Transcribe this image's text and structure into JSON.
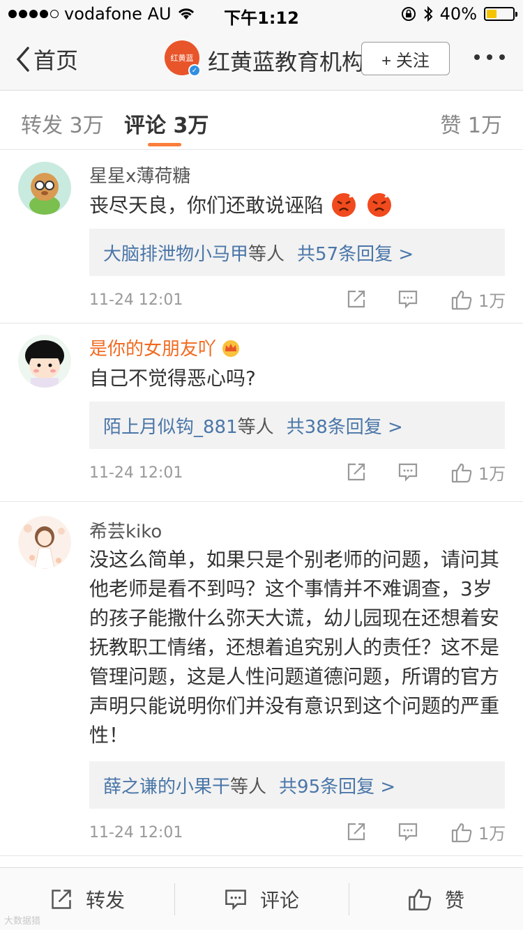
{
  "status_bar": {
    "carrier": "vodafone AU",
    "time": "下午1:12",
    "battery_percent": "40%",
    "battery_level": 0.4
  },
  "nav": {
    "back_label": "首页",
    "org_avatar_text": "红黄蓝",
    "org_name": "红黄蓝教育机构",
    "follow_label": "+ 关注"
  },
  "tabs": [
    {
      "label": "转发 3万"
    },
    {
      "label": "评论 3万"
    },
    {
      "label": "赞 1万"
    }
  ],
  "comments": [
    {
      "user": "星星x薄荷糖",
      "text": "丧尽天良，你们还敢说诬陷",
      "reply_who": "大脑排泄物小马甲",
      "reply_etc": "等人",
      "reply_count": "共57条回复 >",
      "time": "11-24 12:01",
      "likes": "1万"
    },
    {
      "user": "是你的女朋友吖",
      "text": "自己不觉得恶心吗?",
      "reply_who": "陌上月似钩_881",
      "reply_etc": "等人",
      "reply_count": "共38条回复 >",
      "time": "11-24 12:01",
      "likes": "1万"
    },
    {
      "user": "希芸kiko",
      "text": "没这么简单，如果只是个别老师的问题，请问其他老师是看不到吗？这个事情并不难调查，3岁的孩子能撒什么弥天大谎，幼儿园现在还想着安抚教职工情绪，还想着追究别人的责任？这不是管理问题，这是人性问题道德问题，所谓的官方声明只能说明你们并没有意识到这个问题的严重性！",
      "reply_who": "薛之谦的小果干",
      "reply_etc": "等人",
      "reply_count": "共95条回复 >",
      "time": "11-24 12:01",
      "likes": "1万"
    }
  ],
  "toolbar": {
    "repost_label": "转发",
    "comment_label": "评论",
    "like_label": "赞"
  },
  "watermark": "大数据猎"
}
